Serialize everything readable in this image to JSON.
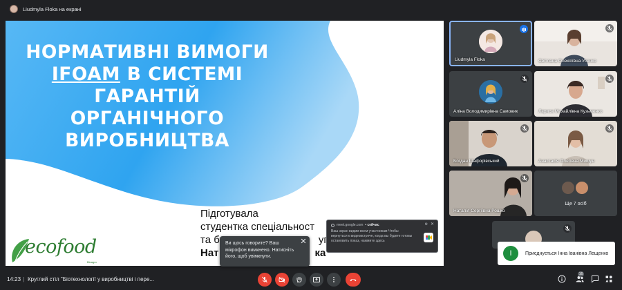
{
  "topbar": {
    "presenting_label": "Liudmyla Floka на екрані"
  },
  "slide": {
    "title_lines": [
      "НОРМАТИВНІ ВИМОГИ",
      "IFOAM",
      " В СИСТЕМІ",
      "ГАРАНТІЙ",
      "ОРГАНІЧНОГО",
      "ВИРОБНИЦТВА"
    ],
    "sub_lines": [
      "Підготувала",
      "студентка спеціальност",
      "та б",
      "упа",
      "Нат",
      "ка"
    ],
    "logo_text": "ecofood",
    "logo_sub": "Bioagro"
  },
  "mic_popup": {
    "text": "Ви щось говорите? Ваш мікрофон вимкнено. Натисніть його, щоб увімкнути."
  },
  "notification": {
    "source": "meet.google.com",
    "time": "• сейчас",
    "body": "Ваш экран видим всем участникам Чтобы вернуться к видеовстрече, когда вы будете готовы остановить показ, нажмите здесь"
  },
  "participants": [
    {
      "name": "Liudmyla Floka"
    },
    {
      "name": "Світлана Олексіївна Усенко"
    },
    {
      "name": "Аліна Володимирівна Самовик"
    },
    {
      "name": "Лариса Михайлівна Кузьменко"
    },
    {
      "name": "Богдан Шафорівський"
    },
    {
      "name": "Анастасія Олегівна Мишун"
    },
    {
      "name": "Наталія Сергіївна Рошко"
    }
  ],
  "more": {
    "label": "Ще 7 осіб"
  },
  "join_popup": {
    "initial": "І",
    "text": "Приєднується Інна Іванівна Лещенко"
  },
  "bottombar": {
    "time": "14:23",
    "separator": "|",
    "meeting_title": "Круглий стіл \"Біотехнології у виробництві і пере...",
    "people_count": "16"
  },
  "colors": {
    "accent": "#8ab4f8",
    "danger": "#ea4335",
    "background": "#202124",
    "tile": "#3c4043"
  }
}
